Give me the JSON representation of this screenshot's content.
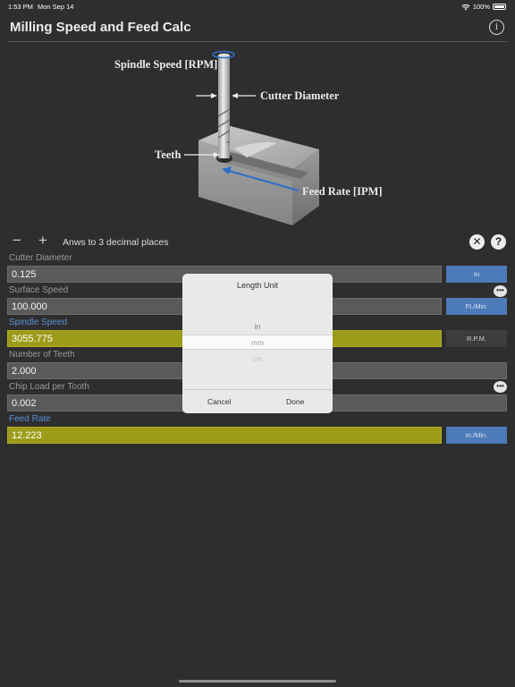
{
  "status": {
    "time": "1:53 PM",
    "date": "Mon Sep 14",
    "battery": "100%"
  },
  "header": {
    "title": "Milling Speed and Feed Calc",
    "info_icon": "i"
  },
  "diagram": {
    "spindle_speed": "Spindle Speed [RPM]",
    "cutter_diameter": "Cutter Diameter",
    "teeth": "Teeth",
    "feed_rate": "Feed Rate [IPM]"
  },
  "precision": {
    "minus": "−",
    "plus": "+",
    "label": "Anws to 3 decimal places",
    "clear": "✕",
    "help": "?"
  },
  "fields": [
    {
      "label": "Cutter Diameter",
      "value": "0.125",
      "unit": "In"
    },
    {
      "label": "Surface Speed",
      "value": "100.000",
      "unit": "Ft./Min."
    },
    {
      "label": "Spindle Speed",
      "value": "3055.775",
      "unit": "R.P.M."
    },
    {
      "label": "Number of Teeth",
      "value": "2.000"
    },
    {
      "label": "Chip Load per Tooth",
      "value": "0.002"
    },
    {
      "label": "Feed Rate",
      "value": "12.223",
      "unit": "In./Min."
    }
  ],
  "picker": {
    "title": "Length Unit",
    "options": [
      "in",
      "mm",
      "cm"
    ],
    "cancel": "Cancel",
    "done": "Done"
  },
  "colors": {
    "calc_field": "#9c9c1a",
    "unit_blue": "#4d7ab8",
    "calc_label": "#5b8fd4"
  }
}
